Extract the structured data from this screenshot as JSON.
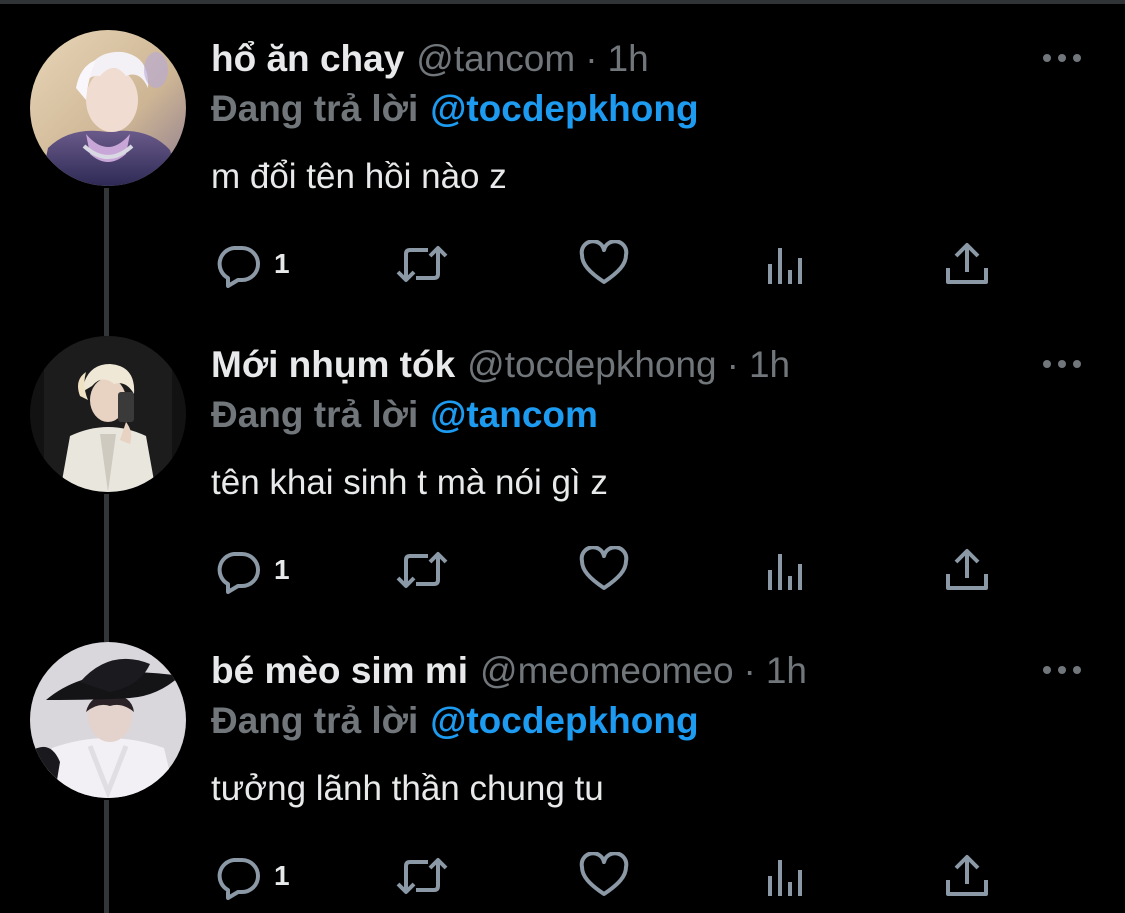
{
  "colors": {
    "background": "#000000",
    "text": "#e7e9ea",
    "muted": "#71767b",
    "accent": "#1d9bf0",
    "thread_line": "#333639"
  },
  "tweets": [
    {
      "display_name": "hổ ăn chay",
      "handle": "@tancom",
      "separator": "·",
      "time": "1h",
      "reply_prefix": "Đang trả lời",
      "reply_to": "@tocdepkhong",
      "text": "m đổi tên hồi nào z",
      "reply_count": "1",
      "avatar": "avatar-photo-white-hair"
    },
    {
      "display_name": "Mới nhụm tók",
      "handle": "@tocdepkhong",
      "separator": "·",
      "time": "1h",
      "reply_prefix": "Đang trả lời",
      "reply_to": "@tancom",
      "text": "tên khai sinh t mà nói gì z",
      "reply_count": "1",
      "avatar": "avatar-photo-mirror-selfie"
    },
    {
      "display_name": "bé mèo sim mi",
      "handle": "@meomeomeo",
      "separator": "·",
      "time": "1h",
      "reply_prefix": "Đang trả lời",
      "reply_to": "@tocdepkhong",
      "text": "tưởng lãnh thần chung tu",
      "reply_count": "1",
      "avatar": "avatar-photo-black-hat"
    }
  ],
  "icons": {
    "more": "more-horizontal-icon",
    "reply": "reply-bubble-icon",
    "retweet": "retweet-icon",
    "like": "heart-icon",
    "views": "analytics-bars-icon",
    "share": "share-upload-icon"
  }
}
